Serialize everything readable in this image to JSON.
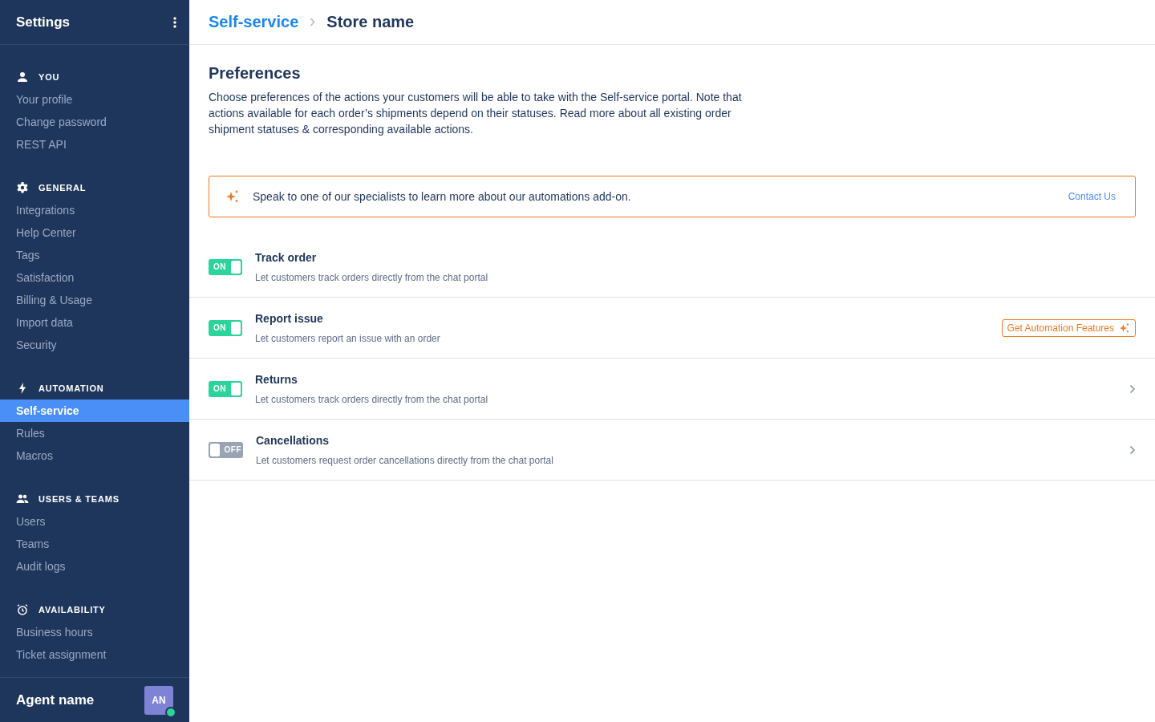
{
  "sidebar": {
    "title": "Settings",
    "sections": [
      {
        "kind": "person",
        "label": "YOU",
        "items": [
          {
            "label": "Your profile",
            "selected": false
          },
          {
            "label": "Change password",
            "selected": false
          },
          {
            "label": "REST API",
            "selected": false
          }
        ]
      },
      {
        "kind": "gear",
        "label": "GENERAL",
        "items": [
          {
            "label": "Integrations",
            "selected": false
          },
          {
            "label": "Help Center",
            "selected": false
          },
          {
            "label": "Tags",
            "selected": false
          },
          {
            "label": "Satisfaction",
            "selected": false
          },
          {
            "label": "Billing & Usage",
            "selected": false
          },
          {
            "label": "Import data",
            "selected": false
          },
          {
            "label": "Security",
            "selected": false
          }
        ]
      },
      {
        "kind": "bolt",
        "label": "AUTOMATION",
        "items": [
          {
            "label": "Self-service",
            "selected": true
          },
          {
            "label": "Rules",
            "selected": false
          },
          {
            "label": "Macros",
            "selected": false
          }
        ]
      },
      {
        "kind": "people",
        "label": "USERS & TEAMS",
        "items": [
          {
            "label": "Users",
            "selected": false
          },
          {
            "label": "Teams",
            "selected": false
          },
          {
            "label": "Audit logs",
            "selected": false
          }
        ]
      },
      {
        "kind": "alarm",
        "label": "AVAILABILITY",
        "items": [
          {
            "label": "Business hours",
            "selected": false
          },
          {
            "label": "Ticket assignment",
            "selected": false
          }
        ]
      }
    ],
    "user": {
      "name": "Agent name",
      "initials": "AN",
      "online": true
    }
  },
  "breadcrumb": [
    {
      "label": "Self-service",
      "link": true
    },
    {
      "label": "Store name",
      "link": false
    }
  ],
  "page": {
    "title": "Preferences",
    "description": "Choose preferences of the actions your customers will be able to take with the Self-service portal. Note that actions available for each order’s shipments depend on their statuses. Read more about all existing order shipment statuses & corresponding available actions."
  },
  "banner": {
    "text": "Speak to one of our specialists to learn more about our automations add-on.",
    "link": "Contact Us"
  },
  "options": [
    {
      "title": "Track order",
      "description": "Let customers track orders directly from the chat portal",
      "on": true,
      "toggle_label": "ON",
      "kind": "plain"
    },
    {
      "title": "Report issue",
      "description": "Let customers report an issue with an order",
      "on": true,
      "toggle_label": "ON",
      "kind": "button",
      "action": "Get Automation Features"
    },
    {
      "title": "Returns",
      "description": "Let customers track orders directly from the chat portal",
      "on": true,
      "toggle_label": "ON",
      "kind": "chevron"
    },
    {
      "title": "Cancellations",
      "description": "Let customers request order cancellations directly from the chat portal",
      "on": false,
      "toggle_label": "OFF",
      "kind": "chevron"
    }
  ]
}
